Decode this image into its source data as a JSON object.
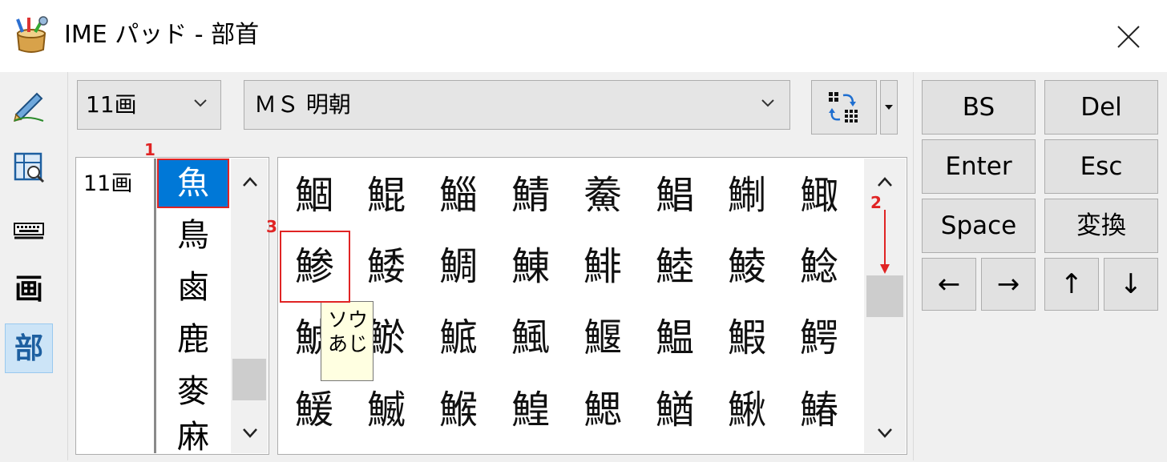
{
  "window": {
    "title": "IME パッド - 部首",
    "icons": {
      "app": "ime-pad-app-icon",
      "close": "close-icon"
    }
  },
  "modes": [
    {
      "name": "handwriting",
      "icon": "handwriting-icon",
      "glyph": ""
    },
    {
      "name": "character-list",
      "icon": "character-list-icon",
      "glyph": ""
    },
    {
      "name": "soft-keyboard",
      "icon": "keyboard-icon",
      "glyph": ""
    },
    {
      "name": "stroke-count",
      "icon": "stroke-count-icon",
      "glyph": "画"
    },
    {
      "name": "radical",
      "icon": "radical-icon",
      "glyph": "部",
      "active": true
    }
  ],
  "toolbar": {
    "stroke_select": "11画",
    "font_select": "ＭＳ 明朝",
    "view_icon": "grid-view-icon"
  },
  "radicals": {
    "stroke_label": "11画",
    "items": [
      "魚",
      "鳥",
      "鹵",
      "鹿",
      "麥",
      "麻"
    ],
    "selected_index": 0
  },
  "characters": [
    [
      "鯝",
      "鯤",
      "鯔",
      "鯖",
      "鯗",
      "鯧",
      "鯯",
      "鯫"
    ],
    [
      "鯵",
      "鯘",
      "鯛",
      "鯟",
      "鯡",
      "鯥",
      "鯪",
      "鯰"
    ],
    [
      "鯱",
      "鯲",
      "鯳",
      "鯴",
      "鰋",
      "鰛",
      "鰕",
      "鰐"
    ],
    [
      "鰀",
      "鰄",
      "鯸",
      "鰉",
      "鰓",
      "鰌",
      "鰍",
      "鰆"
    ]
  ],
  "tooltip": {
    "line1": "ソウ",
    "line2": "あじ"
  },
  "annotations": {
    "n1": "1",
    "n2": "2",
    "n3": "3",
    "color": "#e02424"
  },
  "keys": {
    "bs": "BS",
    "del": "Del",
    "enter": "Enter",
    "esc": "Esc",
    "space": "Space",
    "convert": "変換",
    "left": "←",
    "right": "→",
    "up": "↑",
    "down": "↓"
  },
  "colors": {
    "selection": "#0078d7",
    "active_mode": "#cce4f7",
    "tooltip_bg": "#ffffe1"
  }
}
